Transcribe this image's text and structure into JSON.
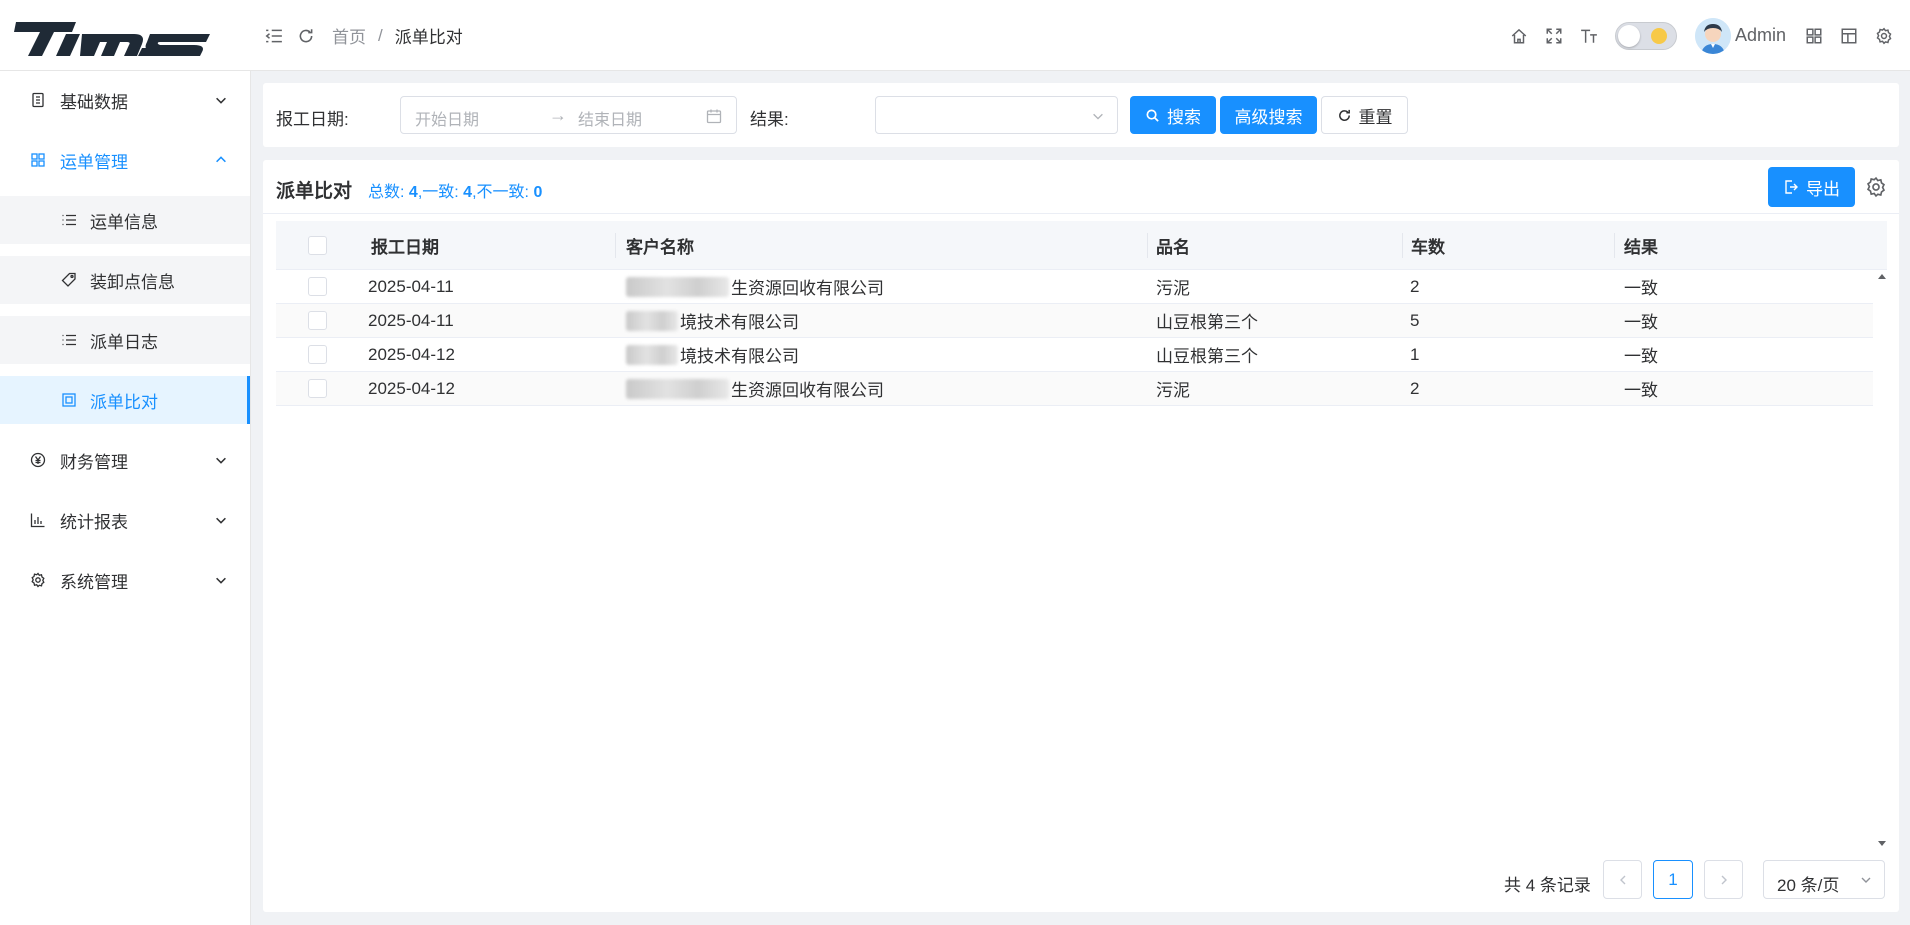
{
  "app": {
    "logo_text": "TIMS"
  },
  "header": {
    "breadcrumb_home": "首页",
    "breadcrumb_sep": "/",
    "breadcrumb_current": "派单比对",
    "user_name": "Admin"
  },
  "sidebar": {
    "items": [
      {
        "label": "基础数据",
        "icon": "database-icon"
      },
      {
        "label": "运单管理",
        "icon": "grid-icon"
      },
      {
        "label": "运单信息",
        "icon": "list-icon"
      },
      {
        "label": "装卸点信息",
        "icon": "tag-icon"
      },
      {
        "label": "派单日志",
        "icon": "list-icon"
      },
      {
        "label": "派单比对",
        "icon": "compare-icon"
      },
      {
        "label": "财务管理",
        "icon": "yen-icon"
      },
      {
        "label": "统计报表",
        "icon": "bar-chart-icon"
      },
      {
        "label": "系统管理",
        "icon": "gear-icon"
      }
    ]
  },
  "search": {
    "date_label": "报工日期:",
    "start_placeholder": "开始日期",
    "range_sep": "→",
    "end_placeholder": "结束日期",
    "result_label": "结果:",
    "search_btn": "搜索",
    "advanced_btn": "高级搜索",
    "reset_btn": "重置"
  },
  "table": {
    "title": "派单比对",
    "summary": {
      "total_label": "总数:",
      "total": "4",
      "match_label": ",一致:",
      "match": "4",
      "mismatch_label": ",不一致:",
      "mismatch": "0"
    },
    "export_btn": "导出",
    "columns": [
      "报工日期",
      "客户名称",
      "品名",
      "车数",
      "结果"
    ],
    "rows": [
      {
        "date": "2025-04-11",
        "customer": "生资源回收有限公司",
        "product": "污泥",
        "count": "2",
        "result": "一致"
      },
      {
        "date": "2025-04-11",
        "customer": "境技术有限公司",
        "product": "山豆根第三个",
        "count": "5",
        "result": "一致"
      },
      {
        "date": "2025-04-12",
        "customer": "境技术有限公司",
        "product": "山豆根第三个",
        "count": "1",
        "result": "一致"
      },
      {
        "date": "2025-04-12",
        "customer": "生资源回收有限公司",
        "product": "污泥",
        "count": "2",
        "result": "一致"
      }
    ]
  },
  "pagination": {
    "total_text": "共 4 条记录",
    "current_page": "1",
    "page_size": "20 条/页"
  },
  "colors": {
    "primary": "#1890ff",
    "background": "#f0f2f5"
  }
}
